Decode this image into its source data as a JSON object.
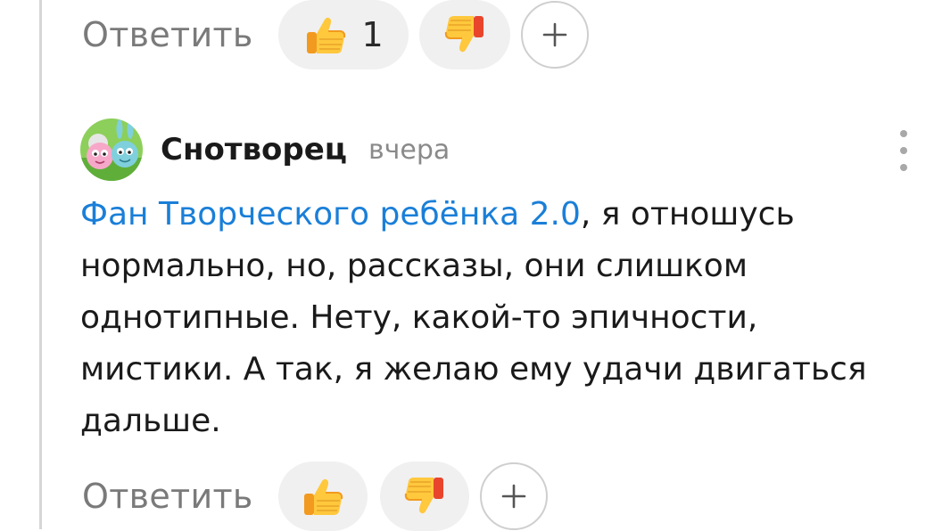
{
  "colors": {
    "mention": "#1a7fd8",
    "reaction_pill_bg": "#f0f0f0",
    "muted_text": "#7a7a7a",
    "thread_line": "#d6d6d6"
  },
  "previous_comment": {
    "reply_label": "Ответить",
    "like": {
      "icon": "thumbs-up-icon",
      "count": "1"
    },
    "dislike": {
      "icon": "thumbs-down-icon"
    },
    "add_reaction": {
      "icon": "plus-icon"
    }
  },
  "comment": {
    "author": "Снотворец",
    "timestamp": "вчера",
    "avatar_icon": "avatar-smeshariki-icon",
    "menu_icon": "more-vertical-icon",
    "mention": "Фан Творческого ребёнка 2.0",
    "text": ", я отношусь нормально, но, рассказы, они слишком однотипные. Нету, какой-то эпичности, мистики. А так, я желаю ему удачи двигаться дальше.",
    "reply_label": "Ответить",
    "like": {
      "icon": "thumbs-up-icon"
    },
    "dislike": {
      "icon": "thumbs-down-icon"
    },
    "add_reaction": {
      "icon": "plus-icon"
    }
  }
}
